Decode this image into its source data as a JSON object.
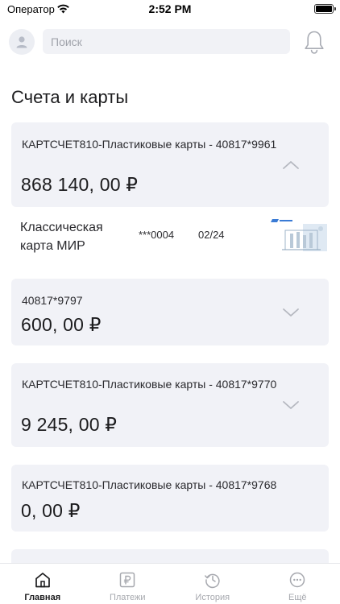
{
  "status_bar": {
    "carrier": "Оператор",
    "time": "2:52 PM"
  },
  "header": {
    "search_placeholder": "Поиск"
  },
  "section": {
    "title": "Счета и карты"
  },
  "accounts": [
    {
      "name": "КАРТСЧЕТ810-Пластиковые карты - 40817*9961",
      "balance": "868 140, 00 ₽",
      "expanded": true,
      "card": {
        "title": "Классическая карта МИР",
        "number": "***0004",
        "expiry": "02/24"
      }
    },
    {
      "name": "40817*9797",
      "balance": "600, 00 ₽",
      "expanded": false
    },
    {
      "name": "КАРТСЧЕТ810-Пластиковые карты - 40817*9770",
      "balance": "9 245, 00 ₽",
      "expanded": false
    },
    {
      "name": "КАРТСЧЕТ810-Пластиковые карты - 40817*9768",
      "balance": "0, 00 ₽",
      "expanded": false
    }
  ],
  "tabs": [
    {
      "label": "Главная",
      "icon": "home-icon",
      "active": true
    },
    {
      "label": "Платежи",
      "icon": "ruble-icon",
      "active": false
    },
    {
      "label": "История",
      "icon": "history-icon",
      "active": false
    },
    {
      "label": "Ещё",
      "icon": "more-icon",
      "active": false
    }
  ],
  "colors": {
    "card_background": "#f1f2f7",
    "inactive_tab": "#a6a8ae",
    "active_tab": "#1c1c1e",
    "card_image_accent": "#3a7bd5"
  }
}
